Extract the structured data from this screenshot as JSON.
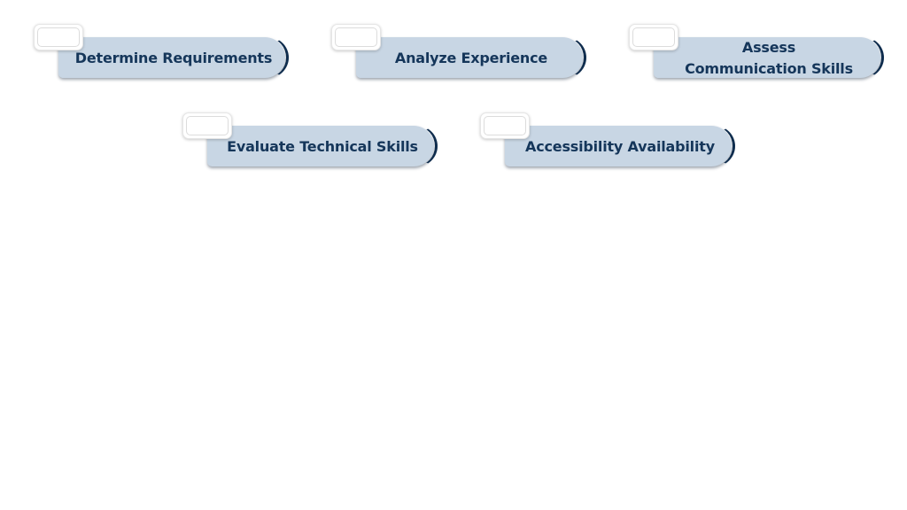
{
  "diagram": {
    "type": "process-steps",
    "colors": {
      "pill_fill": "#c8d6e4",
      "text": "#15365a",
      "edge_accent": "#0f2d4e",
      "tag_fill": "#ffffff",
      "background": "#ffffff"
    },
    "steps": [
      {
        "label": "Determine Requirements",
        "tag_text": ""
      },
      {
        "label": "Analyze Experience",
        "tag_text": ""
      },
      {
        "label": "Assess\nCommunication Skills",
        "tag_text": ""
      },
      {
        "label": "Evaluate Technical Skills",
        "tag_text": ""
      },
      {
        "label": "Accessibility Availability",
        "tag_text": ""
      }
    ]
  }
}
